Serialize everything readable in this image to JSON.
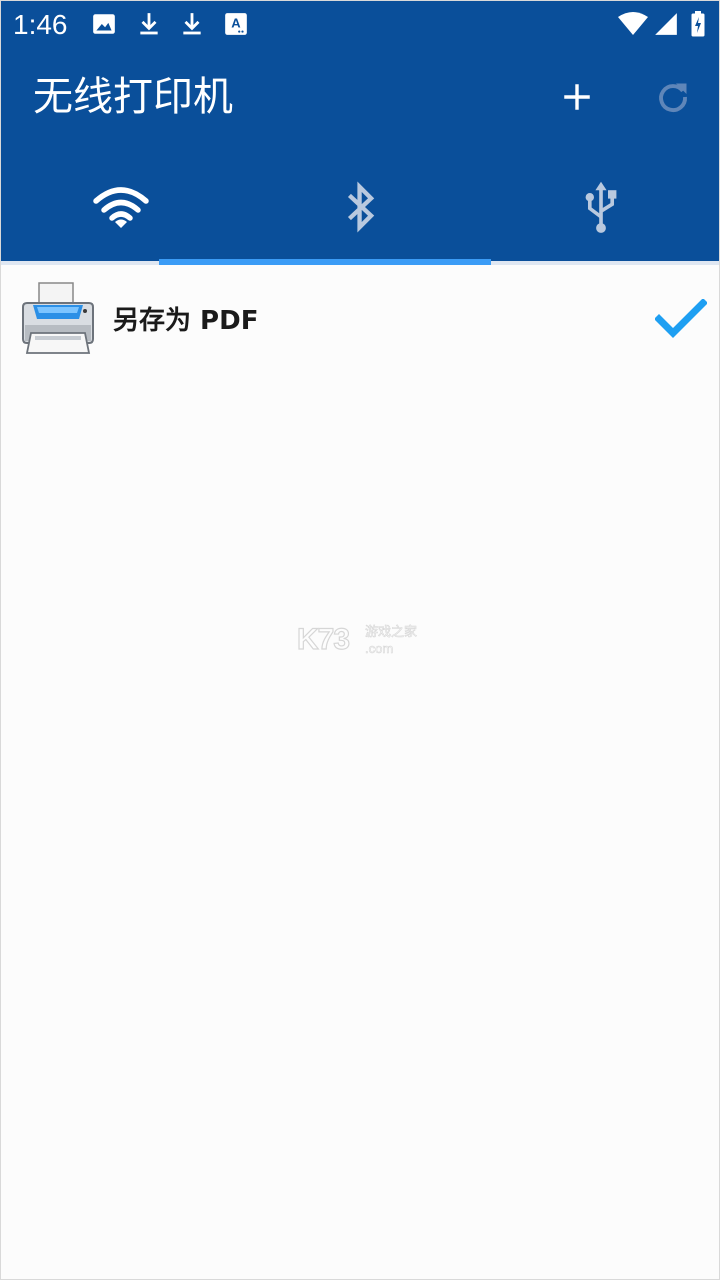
{
  "status_bar": {
    "time": "1:46",
    "icons": [
      "image-icon",
      "download-icon",
      "download-icon",
      "a-box-icon",
      "wifi-signal-icon",
      "cell-signal-icon",
      "battery-charging-icon"
    ]
  },
  "app_bar": {
    "title": "无线打印机",
    "actions": [
      "add-icon",
      "refresh-icon"
    ],
    "background": "#0a4f9a"
  },
  "tabs": {
    "items": [
      {
        "icon": "wifi-icon",
        "selected": false
      },
      {
        "icon": "bluetooth-icon",
        "selected": true
      },
      {
        "icon": "usb-icon",
        "selected": false
      }
    ],
    "indicator_color": "#3b9cf6"
  },
  "list": {
    "items": [
      {
        "label": "另存为 PDF",
        "icon": "printer-icon",
        "checked": true
      }
    ]
  },
  "watermark": {
    "logo": "K73",
    "text_cn": "游戏之家",
    "text_domain": ".com"
  },
  "colors": {
    "accent": "#3b9cf6",
    "check": "#1e9ff2",
    "primary": "#0a4f9a"
  }
}
